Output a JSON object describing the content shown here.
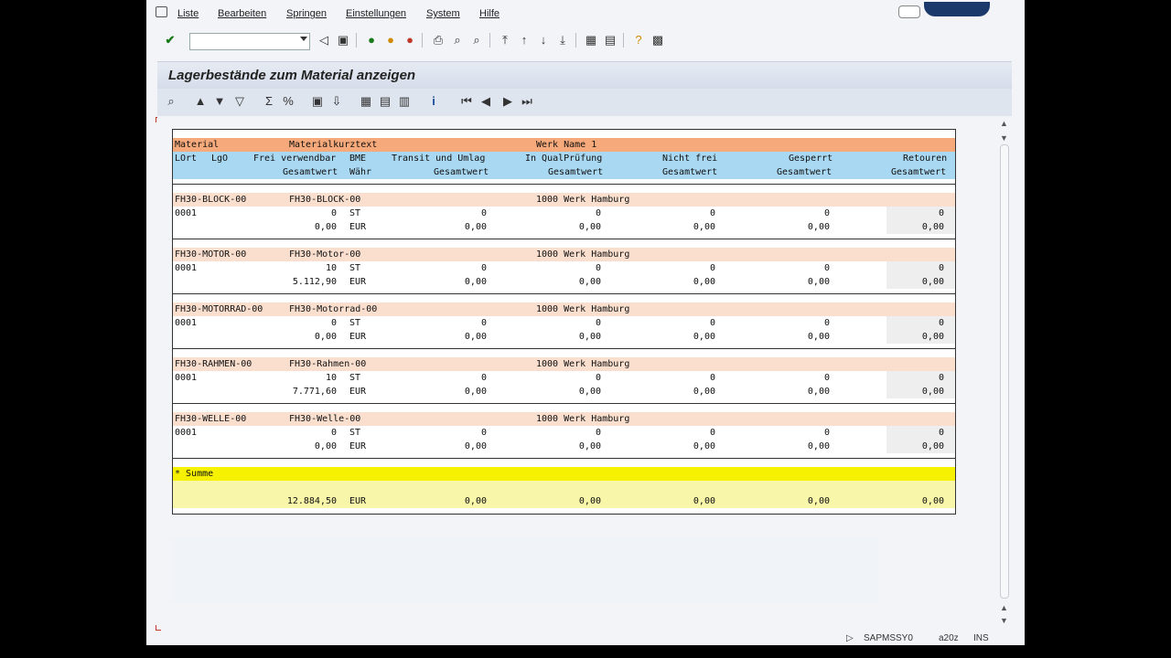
{
  "menu": [
    "Liste",
    "Bearbeiten",
    "Springen",
    "Einstellungen",
    "System",
    "Hilfe"
  ],
  "command_field": {
    "value": ""
  },
  "screen_title": "Lagerbestände zum Material anzeigen",
  "header": {
    "row1": {
      "material": "Material",
      "kurztext": "Materialkurztext",
      "werk": "Werk Name 1"
    },
    "row2": {
      "lort": "LOrt",
      "lgo": "LgO",
      "frei": "Frei verwendbar",
      "bme": "BME",
      "transit": "Transit und Umlag",
      "qual": "In QualPrüfung",
      "nichtfrei": "Nicht frei",
      "gesperrt": "Gesperrt",
      "retouren": "Retouren"
    },
    "row3": {
      "gw1": "Gesamtwert",
      "waehr": "Währ",
      "gw2": "Gesamtwert",
      "gw3": "Gesamtwert",
      "gw4": "Gesamtwert",
      "gw5": "Gesamtwert",
      "gw6": "Gesamtwert"
    }
  },
  "materials": [
    {
      "material": "FH30-BLOCK-00",
      "text": "FH30-BLOCK-00",
      "werk": "1000 Werk Hamburg",
      "lort": "0001",
      "frei": "0",
      "bme": "ST",
      "transit": "0",
      "qual": "0",
      "nichtfrei": "0",
      "gesperrt": "0",
      "retouren": "0",
      "wert": "0,00",
      "waehr": "EUR",
      "w2": "0,00",
      "w3": "0,00",
      "w4": "0,00",
      "w5": "0,00",
      "w6": "0,00"
    },
    {
      "material": "FH30-MOTOR-00",
      "text": "FH30-Motor-00",
      "werk": "1000 Werk Hamburg",
      "lort": "0001",
      "frei": "10",
      "bme": "ST",
      "transit": "0",
      "qual": "0",
      "nichtfrei": "0",
      "gesperrt": "0",
      "retouren": "0",
      "wert": "5.112,90",
      "waehr": "EUR",
      "w2": "0,00",
      "w3": "0,00",
      "w4": "0,00",
      "w5": "0,00",
      "w6": "0,00"
    },
    {
      "material": "FH30-MOTORRAD-00",
      "text": "FH30-Motorrad-00",
      "werk": "1000 Werk Hamburg",
      "lort": "0001",
      "frei": "0",
      "bme": "ST",
      "transit": "0",
      "qual": "0",
      "nichtfrei": "0",
      "gesperrt": "0",
      "retouren": "0",
      "wert": "0,00",
      "waehr": "EUR",
      "w2": "0,00",
      "w3": "0,00",
      "w4": "0,00",
      "w5": "0,00",
      "w6": "0,00"
    },
    {
      "material": "FH30-RAHMEN-00",
      "text": "FH30-Rahmen-00",
      "werk": "1000 Werk Hamburg",
      "lort": "0001",
      "frei": "10",
      "bme": "ST",
      "transit": "0",
      "qual": "0",
      "nichtfrei": "0",
      "gesperrt": "0",
      "retouren": "0",
      "wert": "7.771,60",
      "waehr": "EUR",
      "w2": "0,00",
      "w3": "0,00",
      "w4": "0,00",
      "w5": "0,00",
      "w6": "0,00"
    },
    {
      "material": "FH30-WELLE-00",
      "text": "FH30-Welle-00",
      "werk": "1000 Werk Hamburg",
      "lort": "0001",
      "frei": "0",
      "bme": "ST",
      "transit": "0",
      "qual": "0",
      "nichtfrei": "0",
      "gesperrt": "0",
      "retouren": "0",
      "wert": "0,00",
      "waehr": "EUR",
      "w2": "0,00",
      "w3": "0,00",
      "w4": "0,00",
      "w5": "0,00",
      "w6": "0,00"
    }
  ],
  "summe": {
    "label": "* Summe",
    "wert": "12.884,50",
    "waehr": "EUR",
    "w2": "0,00",
    "w3": "0,00",
    "w4": "0,00",
    "w5": "0,00",
    "w6": "0,00"
  },
  "status": {
    "program": "SAPMSSY0",
    "server": "a20z",
    "mode": "INS"
  },
  "colors": {
    "header_orange": "#f6a97a",
    "header_blue": "#a9d8f2",
    "material_row": "#fadfcf",
    "sum_yellow": "#f5f100"
  }
}
